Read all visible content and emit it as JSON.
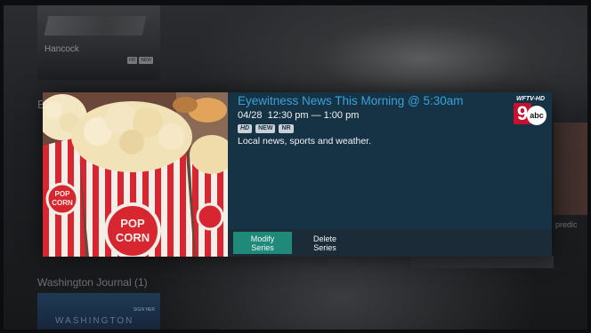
{
  "background": {
    "top_tile_label": "Hancock",
    "top_tile_badges": [
      "HD",
      "NEW"
    ],
    "left_peek_text": "E",
    "right_peek_text": "predic",
    "section_title": "Washington Journal (1)",
    "bottom_tile_tag": "SIGN HER",
    "bottom_tile_watermark": "WASHINGTON"
  },
  "program": {
    "title": "Eyewitness News This Morning @ 5:30am",
    "date": "04/28",
    "time_range": "12:30 pm — 1:00 pm",
    "badges": [
      "HD",
      "NEW",
      "NR"
    ],
    "description": "Local news, sports and weather.",
    "artwork_text": [
      "POP",
      "CORN",
      "POP",
      "CORN"
    ]
  },
  "channel": {
    "callsign": "WFTV-HD",
    "number": "9",
    "network": "abc"
  },
  "actions": {
    "modify_label": "Modify Series",
    "delete_label": "Delete Series"
  },
  "colors": {
    "title": "#3aa3d8",
    "panel_bg": "#163245",
    "action_bar_bg": "#1b2b38",
    "primary_button": "#1f8a7a",
    "logo_red": "#c8102e"
  },
  "icons": {
    "art": "popcorn-artwork",
    "logo": "wftv-abc-logo"
  }
}
